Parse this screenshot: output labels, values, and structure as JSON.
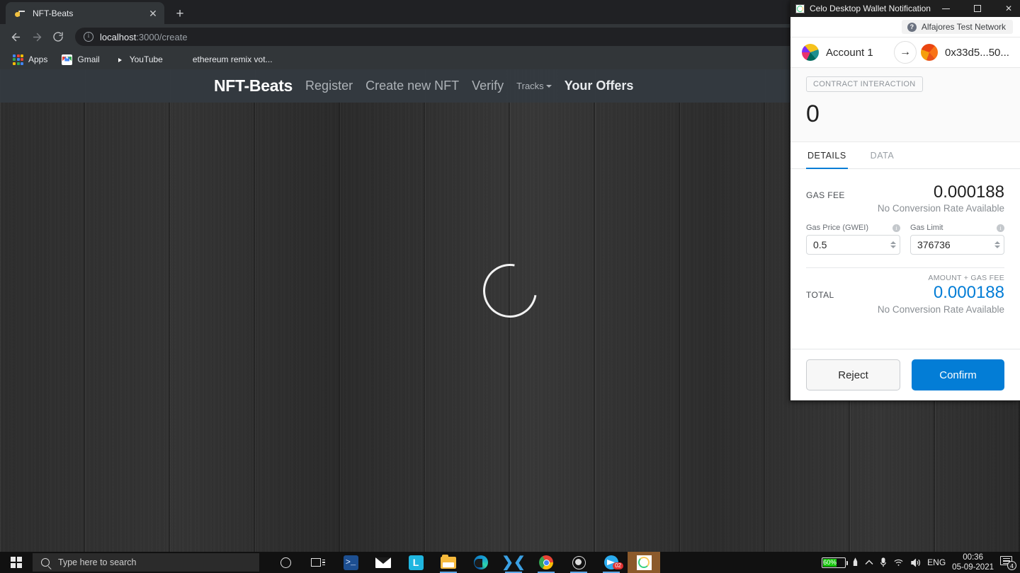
{
  "browser": {
    "tab": {
      "title": "NFT-Beats",
      "favicon": "music-note-icon",
      "close": "✕"
    },
    "new_tab": "+",
    "nav": {
      "back": "back-icon",
      "forward": "forward-icon",
      "reload": "reload-icon"
    },
    "omnibox": {
      "security_icon": "info-circle-icon",
      "host": "localhost",
      "path": ":3000/create",
      "full_url": "localhost:3000/create"
    },
    "bookmarks": [
      {
        "label": "Apps",
        "icon": "apps-grid-icon"
      },
      {
        "label": "Gmail",
        "icon": "gmail-icon"
      },
      {
        "label": "YouTube",
        "icon": "youtube-icon"
      },
      {
        "label": "ethereum remix vot...",
        "icon": "folder-icon"
      }
    ],
    "scrollbar": {
      "left_arrow": "◀",
      "right_arrow": "▶",
      "thumb_percent": 74.5
    }
  },
  "site": {
    "brand": "NFT-Beats",
    "nav": [
      {
        "label": "Register",
        "style": "normal"
      },
      {
        "label": "Create new NFT",
        "style": "normal"
      },
      {
        "label": "Verify",
        "style": "normal"
      },
      {
        "label": "Tracks",
        "style": "dropdown"
      },
      {
        "label": "Your Offers",
        "style": "strong"
      }
    ],
    "loading_spinner": "loading-spinner"
  },
  "wallet": {
    "window_title": "Celo Desktop Wallet Notification",
    "app_icon": "celo-icon",
    "controls": {
      "minimize": "minimize-icon",
      "maximize": "maximize-icon",
      "close": "✕"
    },
    "network": {
      "help_glyph": "?",
      "label": "Alfajores Test Network"
    },
    "from": {
      "name": "Account 1",
      "avatar": "account-blockie"
    },
    "to": {
      "name": "0x33d5...50...",
      "avatar": "recipient-blockie"
    },
    "transfer_arrow": "→",
    "badge": "CONTRACT INTERACTION",
    "amount": "0",
    "tabs": [
      {
        "label": "DETAILS",
        "active": true
      },
      {
        "label": "DATA",
        "active": false
      }
    ],
    "gas": {
      "label": "GAS FEE",
      "amount": "0.000188",
      "conversion": "No Conversion Rate Available",
      "price": {
        "label": "Gas Price (GWEI)",
        "value": "0.5",
        "info": "i"
      },
      "limit": {
        "label": "Gas Limit",
        "value": "376736",
        "info": "i"
      }
    },
    "total": {
      "caption": "AMOUNT + GAS FEE",
      "label": "TOTAL",
      "amount": "0.000188",
      "conversion": "No Conversion Rate Available"
    },
    "actions": {
      "reject": "Reject",
      "confirm": "Confirm"
    },
    "accent_color": "#037dd6"
  },
  "taskbar": {
    "start": "windows-logo",
    "search_placeholder": "Type here to search",
    "pinned": [
      {
        "name": "cortana-icon"
      },
      {
        "name": "task-view-icon"
      },
      {
        "name": "powershell-icon"
      },
      {
        "name": "mail-icon"
      },
      {
        "name": "lastpass-icon",
        "letter": "L"
      },
      {
        "name": "file-explorer-icon"
      },
      {
        "name": "microsoft-edge-icon"
      },
      {
        "name": "visual-studio-code-icon"
      },
      {
        "name": "google-chrome-icon"
      },
      {
        "name": "obs-studio-icon"
      },
      {
        "name": "telegram-icon",
        "badge": "02"
      },
      {
        "name": "celo-wallet-icon",
        "active": true
      }
    ],
    "tray": {
      "battery_percent": "60%",
      "battery_level": 60,
      "pen_icon": "pen-icon",
      "chevron_up": "∧",
      "microphone": "mic-icon",
      "wifi": "wifi-icon",
      "volume": "🔊",
      "language": "ENG",
      "time": "00:36",
      "date": "05-09-2021",
      "notification_count": "4"
    }
  }
}
